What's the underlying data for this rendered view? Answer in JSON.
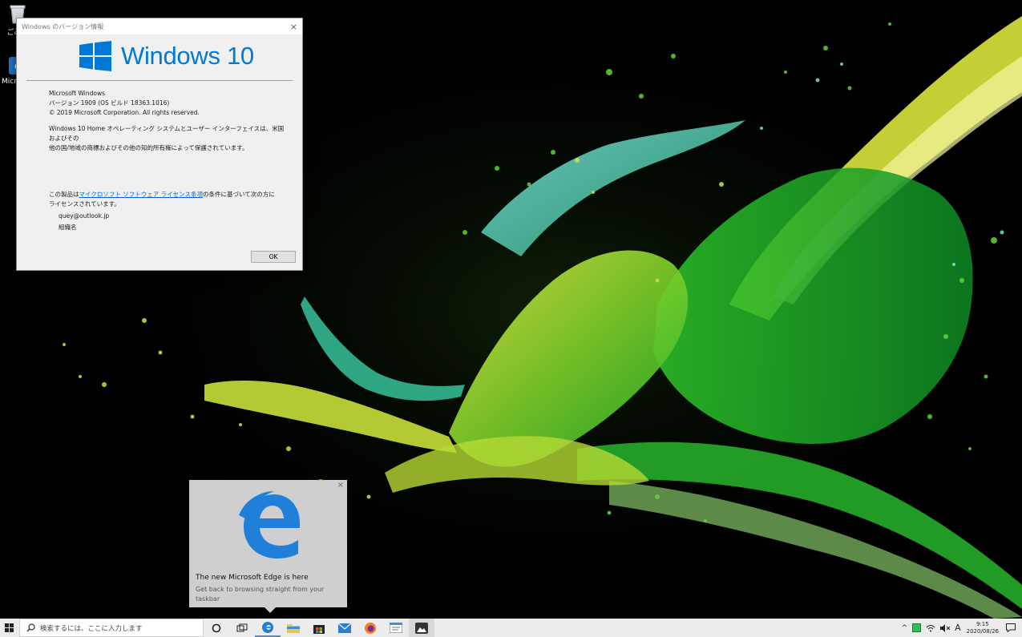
{
  "desktop": {
    "icons": [
      {
        "label": "ごみ箱",
        "icon": "recycle-bin-icon"
      },
      {
        "label": "Microsoft Edge",
        "icon": "edge-icon"
      }
    ]
  },
  "about_dialog": {
    "title": "Windows のバージョン情報",
    "close": "×",
    "logo_text": "Windows 10",
    "product": "Microsoft Windows",
    "version": "バージョン 1909 (OS ビルド 18363.1016)",
    "copyright": "© 2019 Microsoft Corporation. All rights reserved.",
    "trademark_line1": "Windows 10 Home オペレーティング システムとユーザー インターフェイスは、米国およびその",
    "trademark_line2": "他の国/地域の商標およびその他の知的所有権によって保護されています。",
    "license_prefix": "この製品は",
    "license_link": "マイクロソフト ソフトウェア ライセンス条項",
    "license_suffix": "の条件に基づいて次の方に",
    "license_line2": "ライセンスされています。",
    "user": "quey@outlook.jp",
    "org": "組織名",
    "ok_label": "OK"
  },
  "toast": {
    "close": "×",
    "heading": "The new Microsoft Edge is here",
    "subtext": "Get back to browsing straight from your taskbar"
  },
  "taskbar": {
    "search_placeholder": "検索するには、ここに入力します",
    "apps": [
      "cortana-icon",
      "task-view-icon",
      "edge-icon",
      "file-explorer-icon",
      "store-icon",
      "mail-icon",
      "firefox-icon",
      "notepad-icon",
      "photos-icon"
    ],
    "ime": "A",
    "time": "9:15",
    "date": "2020/08/26"
  },
  "colors": {
    "accent": "#0078d7",
    "wallpaper_bg": "#000000",
    "splash_green": "#3fd92b",
    "splash_yellow": "#d8e23a",
    "splash_cyan": "#4fc7c0"
  }
}
